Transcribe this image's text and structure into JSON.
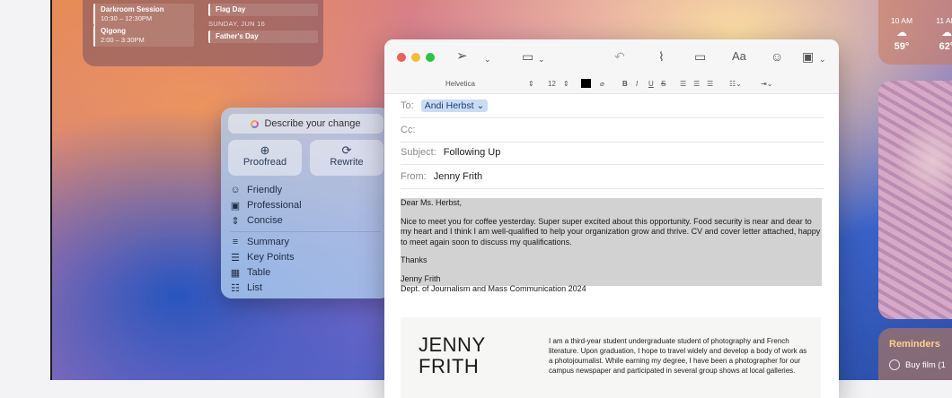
{
  "calendar": {
    "events": [
      {
        "title": "Darkroom Session",
        "time": "10:30 – 12:30PM"
      },
      {
        "title": "Qigong",
        "time": "2:00 – 3:30PM"
      }
    ],
    "right_events": [
      {
        "title": "Flag Day"
      },
      {
        "title": "Father's Day"
      }
    ],
    "day_header": "SUNDAY, JUN 16"
  },
  "weather": {
    "forecast": [
      {
        "time": "10 AM",
        "icon": "partly-cloudy-icon",
        "temp": "59°"
      },
      {
        "time": "11 AM",
        "icon": "partly-cloudy-icon",
        "temp": "62°"
      }
    ]
  },
  "reminders": {
    "title": "Reminders",
    "items": [
      {
        "label": "Buy film (1"
      }
    ]
  },
  "writing_tools": {
    "describe_placeholder": "Describe your change",
    "proofread_label": "Proofread",
    "rewrite_label": "Rewrite",
    "tone_items": [
      "Friendly",
      "Professional",
      "Concise"
    ],
    "format_items": [
      "Summary",
      "Key Points",
      "Table",
      "List"
    ]
  },
  "mail": {
    "toolbar": {
      "send_icon": "paper-plane-icon",
      "header_fields_icon": "header-fields-icon",
      "reply_icon": "reply-arrow-icon",
      "attach_icon": "paperclip-icon",
      "format_label": "Aa",
      "emoji_icon": "smiley-icon",
      "photo_icon": "photo-browser-icon"
    },
    "format_bar": {
      "font": "Helvetica",
      "size": "12",
      "bold": "B",
      "italic": "I",
      "underline": "U",
      "strike": "S",
      "text_color": "#000000"
    },
    "to_label": "To:",
    "to_value": "Andi Herbst",
    "cc_label": "Cc:",
    "subject_label": "Subject:",
    "subject_value": "Following Up",
    "from_label": "From:",
    "from_value": "Jenny Frith",
    "body": {
      "greeting": "Dear Ms. Herbst,",
      "paragraph": "Nice to meet you for coffee yesterday. Super super excited about this opportunity. Food security is near and dear to my heart and I think I am well-qualified to help your organization grow and thrive. CV and cover letter attached, happy to meet again soon to discuss my qualifications.",
      "closing": "Thanks",
      "signature_name": "Jenny Frith",
      "signature_dept": "Dept. of Journalism and Mass Communication 2024"
    },
    "attachment": {
      "name_line1": "JENNY",
      "name_line2": "FRITH",
      "bio": "I am a third-year student undergraduate student of photography and French literature. Upon graduation, I hope to travel widely and develop a body of work as a photojournalist. While earning my degree, I have been a photographer for our campus newspaper and participated in several group shows at local galleries."
    }
  }
}
